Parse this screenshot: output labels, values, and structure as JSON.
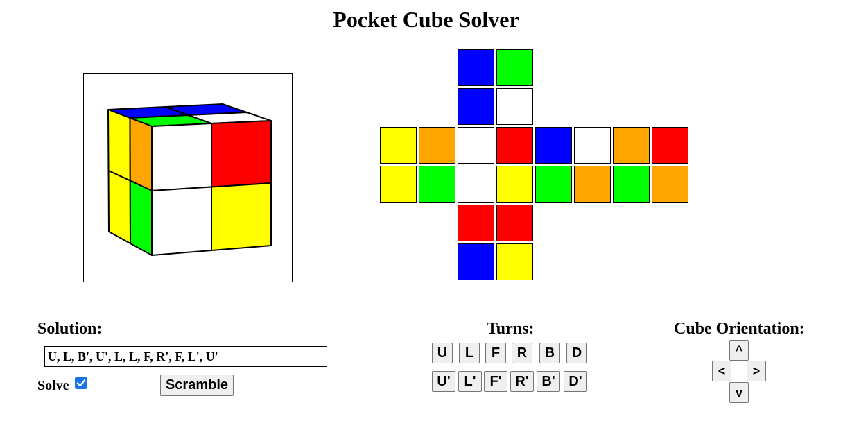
{
  "title": "Pocket Cube Solver",
  "colors": {
    "blue": "#0000ff",
    "green": "#00ff00",
    "white": "#ffffff",
    "yellow": "#ffff00",
    "orange": "#ffa500",
    "red": "#ff0000",
    "checkbox_accent": "#1a73e8"
  },
  "cube_3d": {
    "top": [
      "blue",
      "blue",
      "green",
      "white"
    ],
    "front": [
      "white",
      "red",
      "white",
      "yellow"
    ],
    "left": [
      "yellow",
      "orange",
      "yellow",
      "green"
    ]
  },
  "net": {
    "U": [
      "blue",
      "green",
      "blue",
      "white"
    ],
    "L": [
      "yellow",
      "orange",
      "yellow",
      "green"
    ],
    "F": [
      "white",
      "red",
      "white",
      "yellow"
    ],
    "R": [
      "blue",
      "white",
      "green",
      "orange"
    ],
    "B": [
      "orange",
      "red",
      "green",
      "orange"
    ],
    "D": [
      "red",
      "red",
      "blue",
      "yellow"
    ]
  },
  "solution": {
    "label": "Solution:",
    "value": "U, L, B', U', L, L, F, R', F, L', U'"
  },
  "solve": {
    "label": "Solve",
    "checked": true
  },
  "scramble_label": "Scramble",
  "turns": {
    "label": "Turns:",
    "row1": [
      "U",
      "L",
      "F",
      "R",
      "B",
      "D"
    ],
    "row2": [
      "U'",
      "L'",
      "F'",
      "R'",
      "B'",
      "D'"
    ]
  },
  "orientation": {
    "label": "Cube Orientation:",
    "up": "^",
    "left": "<",
    "right": ">",
    "down": "v"
  }
}
